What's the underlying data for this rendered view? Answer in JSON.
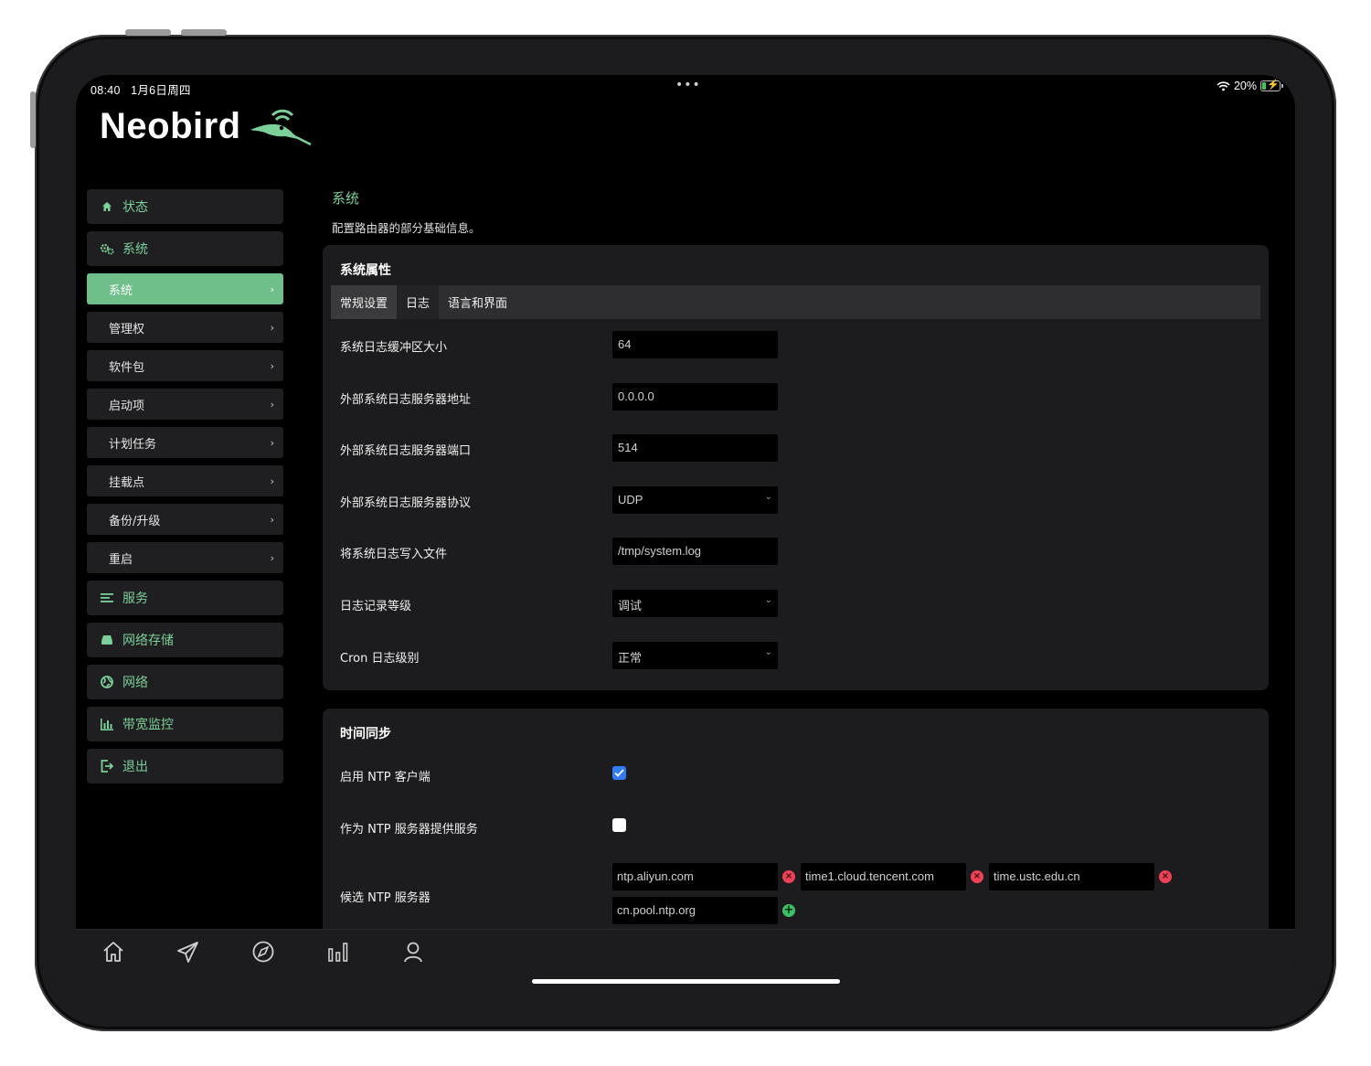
{
  "status_bar": {
    "time": "08:40",
    "date": "1月6日周四",
    "battery": "20%",
    "battery_level": 0.2
  },
  "brand": {
    "name": "Neobird",
    "accent": "#7bd099",
    "active_bg": "#6fbf8a"
  },
  "sidebar": {
    "sections": [
      {
        "label": "状态",
        "icon": "home-icon"
      },
      {
        "label": "系统",
        "icon": "gears-icon"
      }
    ],
    "system_items": [
      {
        "label": "系统",
        "active": true
      },
      {
        "label": "管理权"
      },
      {
        "label": "软件包"
      },
      {
        "label": "启动项"
      },
      {
        "label": "计划任务"
      },
      {
        "label": "挂载点"
      },
      {
        "label": "备份/升级"
      },
      {
        "label": "重启"
      }
    ],
    "more_sections": [
      {
        "label": "服务",
        "icon": "list-icon"
      },
      {
        "label": "网络存储",
        "icon": "drive-icon"
      },
      {
        "label": "网络",
        "icon": "globe-icon"
      },
      {
        "label": "带宽监控",
        "icon": "bar-chart-icon"
      },
      {
        "label": "退出",
        "icon": "logout-icon"
      }
    ]
  },
  "page": {
    "title": "系统",
    "description": "配置路由器的部分基础信息。"
  },
  "system_properties": {
    "title": "系统属性",
    "tabs": [
      "常规设置",
      "日志",
      "语言和界面"
    ],
    "rows": [
      {
        "label": "系统日志缓冲区大小",
        "value": "64",
        "type": "text"
      },
      {
        "label": "外部系统日志服务器地址",
        "value": "0.0.0.0",
        "type": "text"
      },
      {
        "label": "外部系统日志服务器端口",
        "value": "514",
        "type": "text"
      },
      {
        "label": "外部系统日志服务器协议",
        "value": "UDP",
        "type": "select"
      },
      {
        "label": "将系统日志写入文件",
        "value": "/tmp/system.log",
        "type": "text"
      },
      {
        "label": "日志记录等级",
        "value": "调试",
        "type": "select"
      },
      {
        "label": "Cron 日志级别",
        "value": "正常",
        "type": "select"
      }
    ]
  },
  "time_sync": {
    "title": "时间同步",
    "ntp_client": {
      "label": "启用 NTP 客户端",
      "checked": true
    },
    "ntp_server": {
      "label": "作为 NTP 服务器提供服务",
      "checked": false
    },
    "servers_label": "候选 NTP 服务器",
    "servers": [
      "ntp.aliyun.com",
      "time1.cloud.tencent.com",
      "time.ustc.edu.cn",
      "cn.pool.ntp.org"
    ]
  },
  "tab_bar": {
    "items": [
      {
        "icon": "home-icon"
      },
      {
        "icon": "paper-plane-icon"
      },
      {
        "icon": "compass-icon"
      },
      {
        "icon": "bar-chart-icon"
      },
      {
        "icon": "person-icon"
      }
    ]
  }
}
